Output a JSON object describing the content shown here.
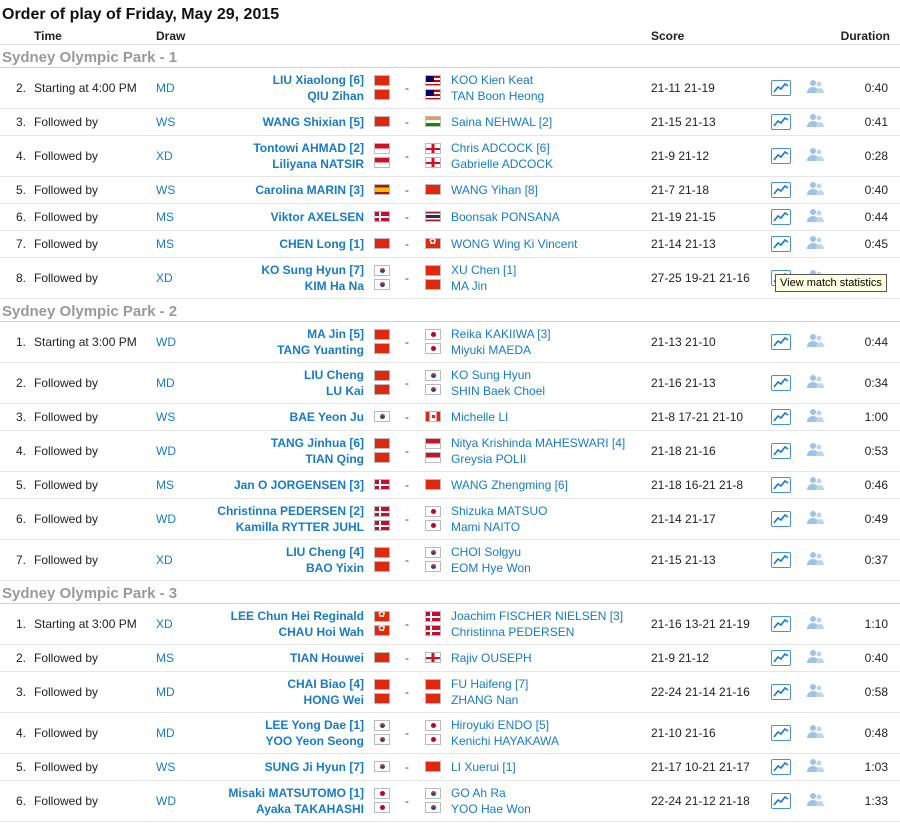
{
  "page": {
    "title": "Order of play of Friday, May 29, 2015"
  },
  "columns": {
    "time": "Time",
    "draw": "Draw",
    "score": "Score",
    "duration": "Duration"
  },
  "tooltip": "View match statistics",
  "colors": {
    "link": "#1a7ac4",
    "court_header": "#999999"
  },
  "icons": {
    "stats": "line-chart-icon",
    "h2h": "head-to-head-icon"
  },
  "courts": [
    {
      "name": "Sydney Olympic Park - 1",
      "matches": [
        {
          "order": "2.",
          "time": "Starting at 4:00 PM",
          "draw": "MD",
          "team1": [
            "LIU Xiaolong [6]",
            "QIU Zihan"
          ],
          "flags1": [
            "CHN",
            "CHN"
          ],
          "team2": [
            "KOO Kien Keat",
            "TAN Boon Heong"
          ],
          "flags2": [
            "MAS",
            "MAS"
          ],
          "score": "21-11 21-19",
          "duration": "0:40"
        },
        {
          "order": "3.",
          "time": "Followed by",
          "draw": "WS",
          "team1": [
            "WANG Shixian [5]"
          ],
          "flags1": [
            "CHN"
          ],
          "team2": [
            "Saina NEHWAL [2]"
          ],
          "flags2": [
            "IND"
          ],
          "score": "21-15 21-13",
          "duration": "0:41"
        },
        {
          "order": "4.",
          "time": "Followed by",
          "draw": "XD",
          "team1": [
            "Tontowi AHMAD [2]",
            "Liliyana NATSIR"
          ],
          "flags1": [
            "INA",
            "INA"
          ],
          "team2": [
            "Chris ADCOCK [6]",
            "Gabrielle ADCOCK"
          ],
          "flags2": [
            "ENG",
            "ENG"
          ],
          "score": "21-9 21-12",
          "duration": "0:28"
        },
        {
          "order": "5.",
          "time": "Followed by",
          "draw": "WS",
          "team1": [
            "Carolina MARIN [3]"
          ],
          "flags1": [
            "ESP"
          ],
          "team2": [
            "WANG Yihan [8]"
          ],
          "flags2": [
            "CHN"
          ],
          "score": "21-7 21-18",
          "duration": "0:40"
        },
        {
          "order": "6.",
          "time": "Followed by",
          "draw": "MS",
          "team1": [
            "Viktor AXELSEN"
          ],
          "flags1": [
            "DEN"
          ],
          "team2": [
            "Boonsak PONSANA"
          ],
          "flags2": [
            "THA"
          ],
          "score": "21-19 21-15",
          "duration": "0:44"
        },
        {
          "order": "7.",
          "time": "Followed by",
          "draw": "MS",
          "team1": [
            "CHEN Long [1]"
          ],
          "flags1": [
            "CHN"
          ],
          "team2": [
            "WONG Wing Ki Vincent"
          ],
          "flags2": [
            "HKG"
          ],
          "score": "21-14 21-13",
          "duration": "0:45"
        },
        {
          "order": "8.",
          "time": "Followed by",
          "draw": "XD",
          "team1": [
            "KO Sung Hyun [7]",
            "KIM Ha Na"
          ],
          "flags1": [
            "KOR",
            "KOR"
          ],
          "team2": [
            "XU Chen [1]",
            "MA Jin"
          ],
          "flags2": [
            "CHN",
            "CHN"
          ],
          "score": "27-25 19-21 21-16",
          "duration": ""
        }
      ]
    },
    {
      "name": "Sydney Olympic Park - 2",
      "matches": [
        {
          "order": "1.",
          "time": "Starting at 3:00 PM",
          "draw": "WD",
          "team1": [
            "MA Jin [5]",
            "TANG Yuanting"
          ],
          "flags1": [
            "CHN",
            "CHN"
          ],
          "team2": [
            "Reika KAKIIWA [3]",
            "Miyuki MAEDA"
          ],
          "flags2": [
            "JPN",
            "JPN"
          ],
          "score": "21-13 21-10",
          "duration": "0:44"
        },
        {
          "order": "2.",
          "time": "Followed by",
          "draw": "MD",
          "team1": [
            "LIU Cheng",
            "LU Kai"
          ],
          "flags1": [
            "CHN",
            "CHN"
          ],
          "team2": [
            "KO Sung Hyun",
            "SHIN Baek Choel"
          ],
          "flags2": [
            "KOR",
            "KOR"
          ],
          "score": "21-16 21-13",
          "duration": "0:34"
        },
        {
          "order": "3.",
          "time": "Followed by",
          "draw": "WS",
          "team1": [
            "BAE Yeon Ju"
          ],
          "flags1": [
            "KOR"
          ],
          "team2": [
            "Michelle LI"
          ],
          "flags2": [
            "CAN"
          ],
          "score": "21-8 17-21 21-10",
          "duration": "1:00"
        },
        {
          "order": "4.",
          "time": "Followed by",
          "draw": "WD",
          "team1": [
            "TANG Jinhua [6]",
            "TIAN Qing"
          ],
          "flags1": [
            "CHN",
            "CHN"
          ],
          "team2": [
            "Nitya Krishinda MAHESWARI [4]",
            "Greysia POLII"
          ],
          "flags2": [
            "INA",
            "INA"
          ],
          "score": "21-18 21-16",
          "duration": "0:53"
        },
        {
          "order": "5.",
          "time": "Followed by",
          "draw": "MS",
          "team1": [
            "Jan O JORGENSEN [3]"
          ],
          "flags1": [
            "DEN"
          ],
          "team2": [
            "WANG Zhengming [6]"
          ],
          "flags2": [
            "CHN"
          ],
          "score": "21-18 16-21 21-8",
          "duration": "0:46"
        },
        {
          "order": "6.",
          "time": "Followed by",
          "draw": "WD",
          "team1": [
            "Christinna PEDERSEN [2]",
            "Kamilla RYTTER JUHL"
          ],
          "flags1": [
            "DEN",
            "DEN"
          ],
          "team2": [
            "Shizuka MATSUO",
            "Mami NAITO"
          ],
          "flags2": [
            "JPN",
            "JPN"
          ],
          "score": "21-14 21-17",
          "duration": "0:49"
        },
        {
          "order": "7.",
          "time": "Followed by",
          "draw": "XD",
          "team1": [
            "LIU Cheng [4]",
            "BAO Yixin"
          ],
          "flags1": [
            "CHN",
            "CHN"
          ],
          "team2": [
            "CHOI Solgyu",
            "EOM Hye Won"
          ],
          "flags2": [
            "KOR",
            "KOR"
          ],
          "score": "21-15 21-13",
          "duration": "0:37"
        }
      ]
    },
    {
      "name": "Sydney Olympic Park - 3",
      "matches": [
        {
          "order": "1.",
          "time": "Starting at 3:00 PM",
          "draw": "XD",
          "team1": [
            "LEE Chun Hei Reginald",
            "CHAU Hoi Wah"
          ],
          "flags1": [
            "HKG",
            "HKG"
          ],
          "team2": [
            "Joachim FISCHER NIELSEN [3]",
            "Christinna PEDERSEN"
          ],
          "flags2": [
            "DEN",
            "DEN"
          ],
          "score": "21-16 13-21 21-19",
          "duration": "1:10"
        },
        {
          "order": "2.",
          "time": "Followed by",
          "draw": "MS",
          "team1": [
            "TIAN Houwei"
          ],
          "flags1": [
            "CHN"
          ],
          "team2": [
            "Rajiv OUSEPH"
          ],
          "flags2": [
            "ENG"
          ],
          "score": "21-9 21-12",
          "duration": "0:40"
        },
        {
          "order": "3.",
          "time": "Followed by",
          "draw": "MD",
          "team1": [
            "CHAI Biao [4]",
            "HONG Wei"
          ],
          "flags1": [
            "CHN",
            "CHN"
          ],
          "team2": [
            "FU Haifeng [7]",
            "ZHANG Nan"
          ],
          "flags2": [
            "CHN",
            "CHN"
          ],
          "score": "22-24 21-14 21-16",
          "duration": "0:58"
        },
        {
          "order": "4.",
          "time": "Followed by",
          "draw": "MD",
          "team1": [
            "LEE Yong Dae [1]",
            "YOO Yeon Seong"
          ],
          "flags1": [
            "KOR",
            "KOR"
          ],
          "team2": [
            "Hiroyuki ENDO [5]",
            "Kenichi HAYAKAWA"
          ],
          "flags2": [
            "JPN",
            "JPN"
          ],
          "score": "21-10 21-16",
          "duration": "0:48"
        },
        {
          "order": "5.",
          "time": "Followed by",
          "draw": "WS",
          "team1": [
            "SUNG Ji Hyun [7]"
          ],
          "flags1": [
            "KOR"
          ],
          "team2": [
            "LI Xuerui [1]"
          ],
          "flags2": [
            "CHN"
          ],
          "score": "21-17 10-21 21-17",
          "duration": "1:03"
        },
        {
          "order": "6.",
          "time": "Followed by",
          "draw": "WD",
          "team1": [
            "Misaki MATSUTOMO [1]",
            "Ayaka TAKAHASHI"
          ],
          "flags1": [
            "JPN",
            "JPN"
          ],
          "team2": [
            "GO Ah Ra",
            "YOO Hae Won"
          ],
          "flags2": [
            "KOR",
            "KOR"
          ],
          "score": "22-24 21-12 21-18",
          "duration": "1:33"
        }
      ]
    }
  ]
}
